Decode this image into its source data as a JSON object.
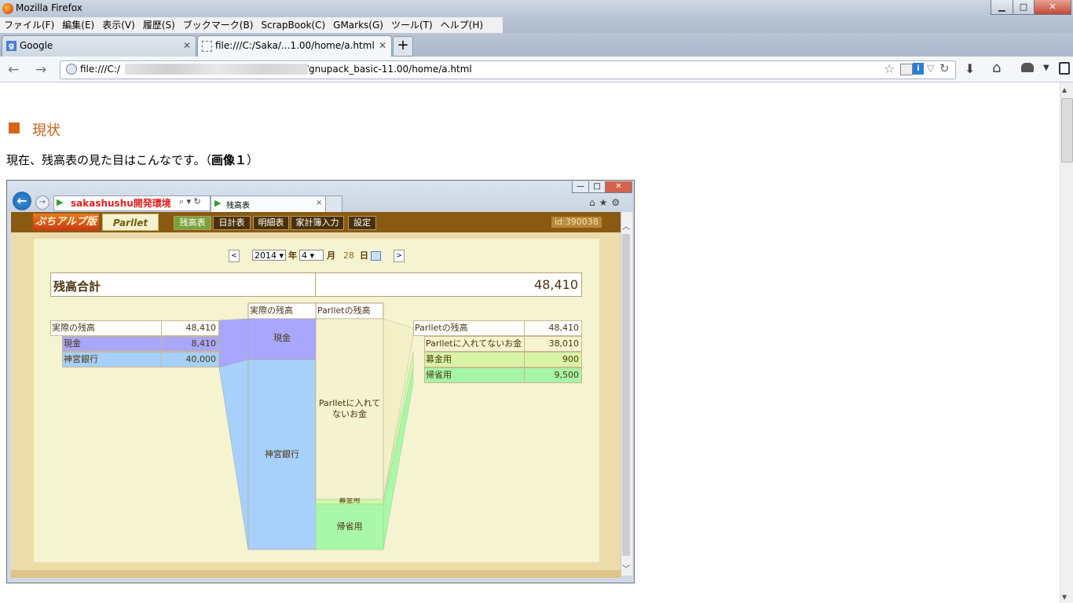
{
  "window": {
    "title": "Mozilla Firefox",
    "buttons": {
      "minimize": "▁",
      "maximize": "□",
      "close": "✕"
    }
  },
  "menu": [
    "ファイル(F)",
    "編集(E)",
    "表示(V)",
    "履歴(S)",
    "ブックマーク(B)",
    "ScrapBook(C)",
    "GMarks(G)",
    "ツール(T)",
    "ヘルプ(H)"
  ],
  "tabs": [
    {
      "label": "Google"
    },
    {
      "label": "file:///C:/Saka/...1.00/home/a.html"
    }
  ],
  "newtab": "+",
  "url": {
    "prefix": "file:///C:/",
    "suffix": "/gnupack_basic-11.00/home/a.html"
  },
  "nav": {
    "back": "←",
    "forward": "→",
    "star": "☆",
    "reload": "↻",
    "download": "⬇",
    "home": "⌂"
  },
  "section": {
    "title": "現状"
  },
  "bodytext": {
    "main": "現在、残高表の見た目はこんなです。（",
    "bold": "画像１",
    "end": "）"
  },
  "screenshot": {
    "ie": {
      "url": "sakashushu開発環境",
      "tab": "残高表",
      "search_icons": "⌕ ▾ ↻",
      "tab_close": "×",
      "right_icons": "⌂★⚙",
      "back": "←",
      "forward": "→",
      "win": [
        "—",
        "□",
        "✕"
      ]
    },
    "app": {
      "logo1": "ぷちアルプ版",
      "logo2": "Parllet",
      "nav_tabs": [
        "残高表",
        "日計表",
        "明細表",
        "家計簿入力",
        "設定"
      ],
      "id": "id:390038",
      "date": {
        "prev": "<",
        "next": ">",
        "year": "2014",
        "year_label": "年",
        "month": "4",
        "month_label": "月",
        "day": "28",
        "day_label": "日"
      },
      "total": {
        "label": "残高合計",
        "value": "48,410"
      },
      "left": {
        "header_label": "実際の残高",
        "header_value": "48,410",
        "rows": [
          {
            "label": "現金",
            "value": "8,410",
            "color": "#a9a6ff"
          },
          {
            "label": "神宮銀行",
            "value": "40,000",
            "color": "#a7d0fa"
          }
        ]
      },
      "mid": {
        "col1": "実際の残高",
        "col2": "Parlletの残高",
        "block_cash": "現金",
        "block_bank": "神宮銀行",
        "block_unassigned": "Parlletに入れてないお金",
        "block_fund": "募金用",
        "block_home": "帰省用"
      },
      "right": {
        "header_label": "Parlletの残高",
        "header_value": "48,410",
        "rows": [
          {
            "label": "Parlletに入れてないお金",
            "value": "38,010",
            "color": "#f5f3d0"
          },
          {
            "label": "募金用",
            "value": "900",
            "color": "#d8f5a6"
          },
          {
            "label": "帰省用",
            "value": "9,500",
            "color": "#a6f5a6"
          }
        ]
      },
      "colors": {
        "cash": "#a9a6ff",
        "bank": "#a7d0fa",
        "unassigned": "#f5f2cf",
        "fund": "#d6f8a6",
        "home": "#a9f8a9",
        "header_brown": "#8a5a12",
        "panel": "#f5f3d0"
      }
    }
  }
}
